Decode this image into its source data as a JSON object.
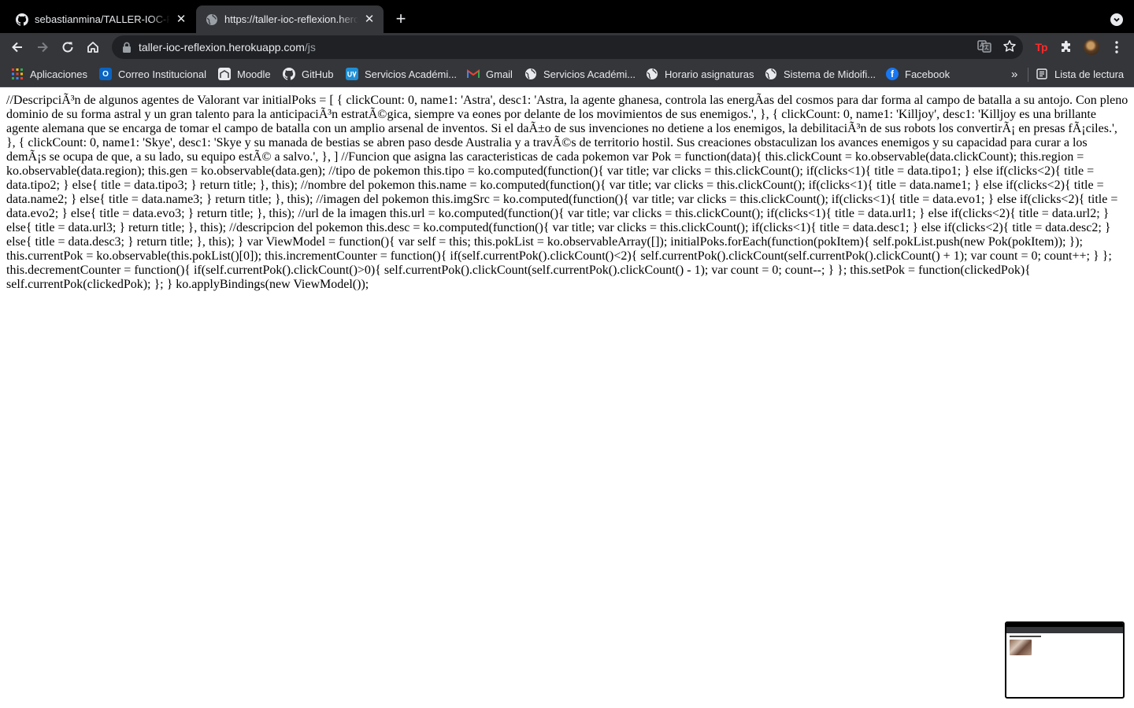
{
  "browser": {
    "tabs": [
      {
        "title": "sebastianmina/TALLER-IOC-RE",
        "icon": "github-icon",
        "active": false
      },
      {
        "title": "https://taller-ioc-reflexion.hero",
        "icon": "globe-icon",
        "active": true
      }
    ],
    "new_tab_label": "+",
    "address": {
      "host": "taller-ioc-reflexion.herokuapp.com",
      "path": "/js"
    },
    "extensions": {
      "tp_label": "Tp"
    },
    "bookmarks": [
      {
        "label": "Aplicaciones",
        "icon": "apps-grid-icon"
      },
      {
        "label": "Correo Institucional",
        "icon": "outlook-icon"
      },
      {
        "label": "Moodle",
        "icon": "moodle-icon"
      },
      {
        "label": "GitHub",
        "icon": "github-icon"
      },
      {
        "label": "Servicios Académi...",
        "icon": "uv-icon"
      },
      {
        "label": "Gmail",
        "icon": "gmail-icon"
      },
      {
        "label": "Servicios Académi...",
        "icon": "globe-icon"
      },
      {
        "label": "Horario asignaturas",
        "icon": "globe-icon"
      },
      {
        "label": "Sistema de Midoifi...",
        "icon": "globe-icon"
      },
      {
        "label": "Facebook",
        "icon": "facebook-icon"
      }
    ],
    "bookmarks_overflow_label": "»",
    "reading_list_label": "Lista de lectura"
  },
  "page": {
    "code": "//DescripciÃ³n de algunos agentes de Valorant var initialPoks = [ { clickCount: 0, name1: 'Astra', desc1: 'Astra, la agente ghanesa, controla las energÃas del cosmos para dar forma al campo de batalla a su antojo. Con pleno dominio de su forma astral y un gran talento para la anticipaciÃ³n estratÃ©gica, siempre va eones por delante de los movimientos de sus enemigos.', }, { clickCount: 0, name1: 'Killjoy', desc1: 'Killjoy es una brillante agente alemana que se encarga de tomar el campo de batalla con un amplio arsenal de inventos. Si el daÃ±o de sus invenciones no detiene a los enemigos, la debilitaciÃ³n de sus robots los convertirÃ¡ en presas fÃ¡ciles.', }, { clickCount: 0, name1: 'Skye', desc1: 'Skye y su manada de bestias se abren paso desde Australia y a travÃ©s de territorio hostil. Sus creaciones obstaculizan los avances enemigos y su capacidad para curar a los demÃ¡s se ocupa de que, a su lado, su equipo estÃ© a salvo.', }, ] //Funcion que asigna las caracteristicas de cada pokemon var Pok = function(data){ this.clickCount = ko.observable(data.clickCount); this.region = ko.observable(data.region); this.gen = ko.observable(data.gen); //tipo de pokemon this.tipo = ko.computed(function(){ var title; var clicks = this.clickCount(); if(clicks<1){ title = data.tipo1; } else if(clicks<2){ title = data.tipo2; } else{ title = data.tipo3; } return title; }, this); //nombre del pokemon this.name = ko.computed(function(){ var title; var clicks = this.clickCount(); if(clicks<1){ title = data.name1; } else if(clicks<2){ title = data.name2; } else{ title = data.name3; } return title; }, this); //imagen del pokemon this.imgSrc = ko.computed(function(){ var title; var clicks = this.clickCount(); if(clicks<1){ title = data.evo1; } else if(clicks<2){ title = data.evo2; } else{ title = data.evo3; } return title; }, this); //url de la imagen this.url = ko.computed(function(){ var title; var clicks = this.clickCount(); if(clicks<1){ title = data.url1; } else if(clicks<2){ title = data.url2; } else{ title = data.url3; } return title; }, this); //descripcion del pokemon this.desc = ko.computed(function(){ var title; var clicks = this.clickCount(); if(clicks<1){ title = data.desc1; } else if(clicks<2){ title = data.desc2; } else{ title = data.desc3; } return title; }, this); } var ViewModel = function(){ var self = this; this.pokList = ko.observableArray([]); initialPoks.forEach(function(pokItem){ self.pokList.push(new Pok(pokItem)); }); this.currentPok = ko.observable(this.pokList()[0]); this.incrementCounter = function(){ if(self.currentPok().clickCount()<2){ self.currentPok().clickCount(self.currentPok().clickCount() + 1); var count = 0; count++; } }; this.decrementCounter = function(){ if(self.currentPok().clickCount()>0){ self.currentPok().clickCount(self.currentPok().clickCount() - 1); var count = 0; count--; } }; this.setPok = function(clickedPok){ self.currentPok(clickedPok); }; } ko.applyBindings(new ViewModel());"
  },
  "colors": {
    "tabstrip_bg": "#000000",
    "toolbar_bg": "#35363a",
    "omnibox_bg": "#202124",
    "text_light": "#e8eaed",
    "text_dim": "#9aa0a6",
    "tp_red": "#ff2a2a",
    "page_bg": "#ffffff"
  }
}
